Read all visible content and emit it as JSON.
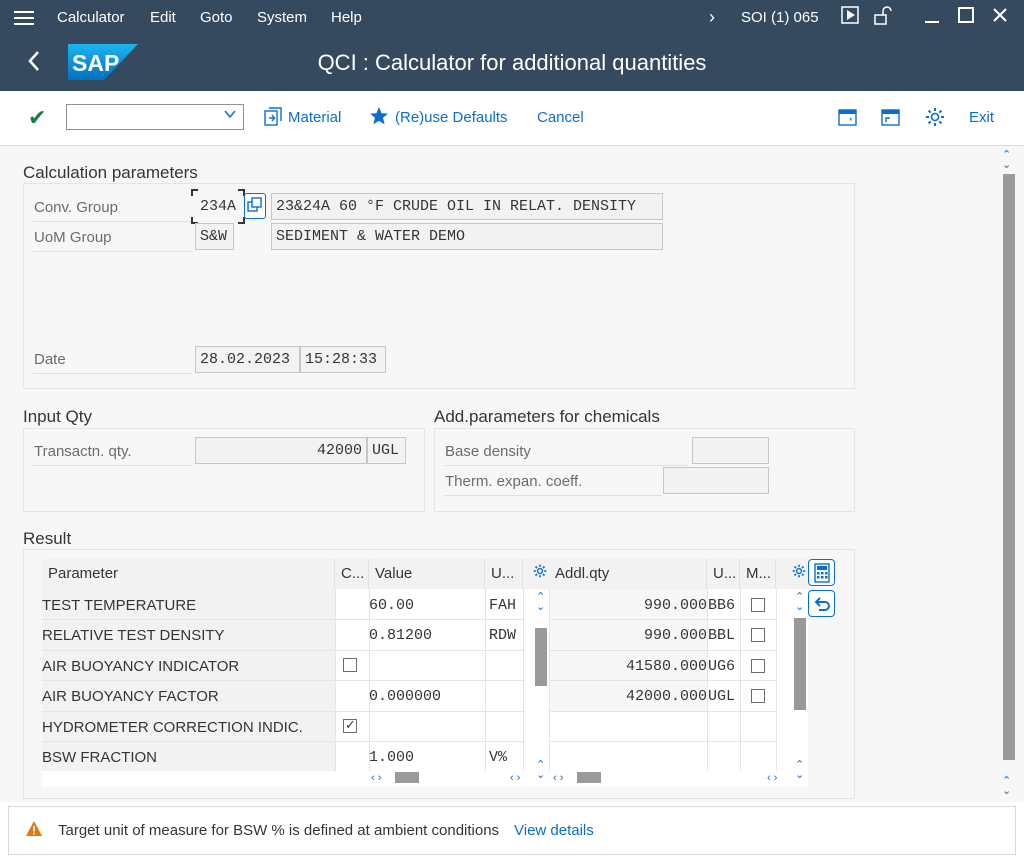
{
  "menu": {
    "items": [
      "Calculator",
      "Edit",
      "Goto",
      "System",
      "Help"
    ],
    "system_info": "SOI (1) 065"
  },
  "title": {
    "logo": "SAP",
    "text": "QCI : Calculator for additional quantities"
  },
  "toolbar": {
    "okcode_value": "",
    "material_label": "Material",
    "reuse_defaults_label": "(Re)use Defaults",
    "cancel_label": "Cancel",
    "exit_label": "Exit"
  },
  "calc_params": {
    "title": "Calculation parameters",
    "conv_group_label": "Conv. Group",
    "conv_group_value": "234A",
    "conv_group_desc": "23&24A 60 °F CRUDE OIL IN RELAT. DENSITY",
    "uom_group_label": "UoM Group",
    "uom_group_value": "S&W",
    "uom_group_desc": "SEDIMENT & WATER DEMO",
    "date_label": "Date",
    "date_value": "28.02.2023",
    "time_value": "15:28:33"
  },
  "input_qty": {
    "title": "Input Qty",
    "transactn_label": "Transactn. qty.",
    "transactn_value": "42000",
    "transactn_unit": "UGL"
  },
  "add_params": {
    "title": "Add.parameters for chemicals",
    "base_density_label": "Base density",
    "base_density_value": "",
    "therm_label": "Therm. expan. coeff.",
    "therm_value": ""
  },
  "result": {
    "title": "Result",
    "headers": {
      "parameter": "Parameter",
      "c": "C...",
      "value": "Value",
      "u": "U...",
      "addl_qty": "Addl.qty",
      "u2": "U...",
      "m": "M..."
    },
    "rows": [
      {
        "parameter": "TEST TEMPERATURE",
        "value": "60.00",
        "unit": "FAH"
      },
      {
        "parameter": "RELATIVE TEST DENSITY",
        "value": "0.81200",
        "unit": "RDW"
      },
      {
        "parameter": "AIR BUOYANCY INDICATOR",
        "value": "",
        "unit": ""
      },
      {
        "parameter": "AIR BUOYANCY FACTOR",
        "value": "0.000000",
        "unit": ""
      },
      {
        "parameter": "HYDROMETER CORRECTION INDIC.",
        "value": "",
        "unit": ""
      },
      {
        "parameter": "BSW FRACTION",
        "value": "1.000",
        "unit": "V%"
      }
    ],
    "addl_rows": [
      {
        "qty": "990.000",
        "unit": "BB6"
      },
      {
        "qty": "990.000",
        "unit": "BBL"
      },
      {
        "qty": "41580.000",
        "unit": "UG6"
      },
      {
        "qty": "42000.000",
        "unit": "UGL"
      }
    ]
  },
  "message": {
    "text": "Target unit of measure for BSW % is defined at ambient conditions",
    "link": "View details"
  }
}
